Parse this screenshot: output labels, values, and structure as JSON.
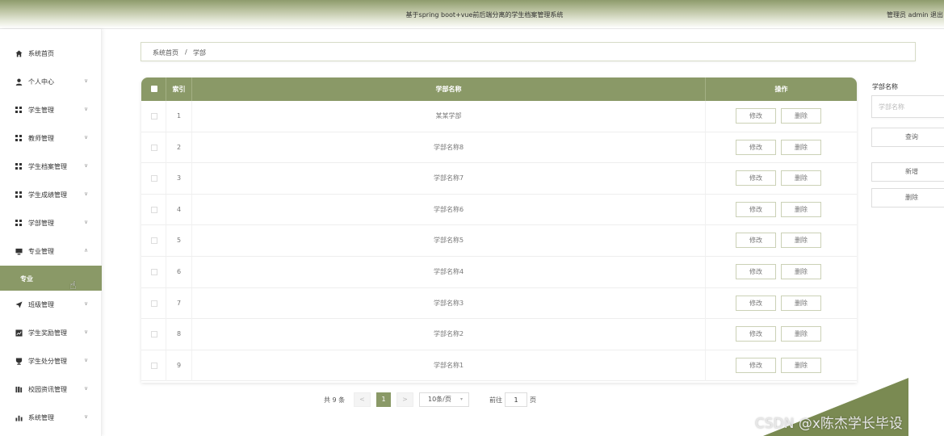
{
  "header": {
    "title": "基于spring boot+vue前后端分离的学生档案管理系统",
    "user": "管理员 admin",
    "logout": "退出"
  },
  "sidebar": {
    "items": [
      {
        "label": "系统首页",
        "icon": "home-icon"
      },
      {
        "label": "个人中心",
        "icon": "user-icon"
      },
      {
        "label": "学生管理",
        "icon": "grid-icon"
      },
      {
        "label": "教师管理",
        "icon": "grid-icon"
      },
      {
        "label": "学生档案管理",
        "icon": "grid-icon"
      },
      {
        "label": "学生成绩管理",
        "icon": "grid-icon"
      },
      {
        "label": "学部管理",
        "icon": "grid-icon"
      },
      {
        "label": "专业管理",
        "icon": "monitor-icon"
      },
      {
        "label": "班级管理",
        "icon": "send-icon"
      },
      {
        "label": "学生奖励管理",
        "icon": "chart-icon"
      },
      {
        "label": "学生处分管理",
        "icon": "trophy-icon"
      },
      {
        "label": "校园资讯管理",
        "icon": "book-icon"
      },
      {
        "label": "系统管理",
        "icon": "bar-chart-icon"
      }
    ],
    "submenu_label": "专业"
  },
  "breadcrumb": {
    "home": "系统首页",
    "separator": "/",
    "current": "学部"
  },
  "table": {
    "columns": [
      "",
      "索引",
      "学部名称",
      "操作"
    ],
    "rows": [
      {
        "index": "1",
        "name": "某某学部"
      },
      {
        "index": "2",
        "name": "学部名称8"
      },
      {
        "index": "3",
        "name": "学部名称7"
      },
      {
        "index": "4",
        "name": "学部名称6"
      },
      {
        "index": "5",
        "name": "学部名称5"
      },
      {
        "index": "6",
        "name": "学部名称4"
      },
      {
        "index": "7",
        "name": "学部名称3"
      },
      {
        "index": "8",
        "name": "学部名称2"
      },
      {
        "index": "9",
        "name": "学部名称1"
      }
    ],
    "edit_label": "修改",
    "delete_label": "删除"
  },
  "pagination": {
    "total": "共 9 条",
    "prev": "<",
    "current": "1",
    "next": ">",
    "page_size": "10条/页",
    "goto": "前往",
    "goto_value": "1",
    "page_suffix": "页"
  },
  "search": {
    "label": "学部名称",
    "placeholder": "学部名称",
    "query_button": "查询",
    "add_button": "新增",
    "delete_button": "删除"
  },
  "watermark": "CSDN @x陈杰学长毕设",
  "colors": {
    "accent": "#8a9967",
    "header_gradient_top": "#8e9b6c"
  }
}
